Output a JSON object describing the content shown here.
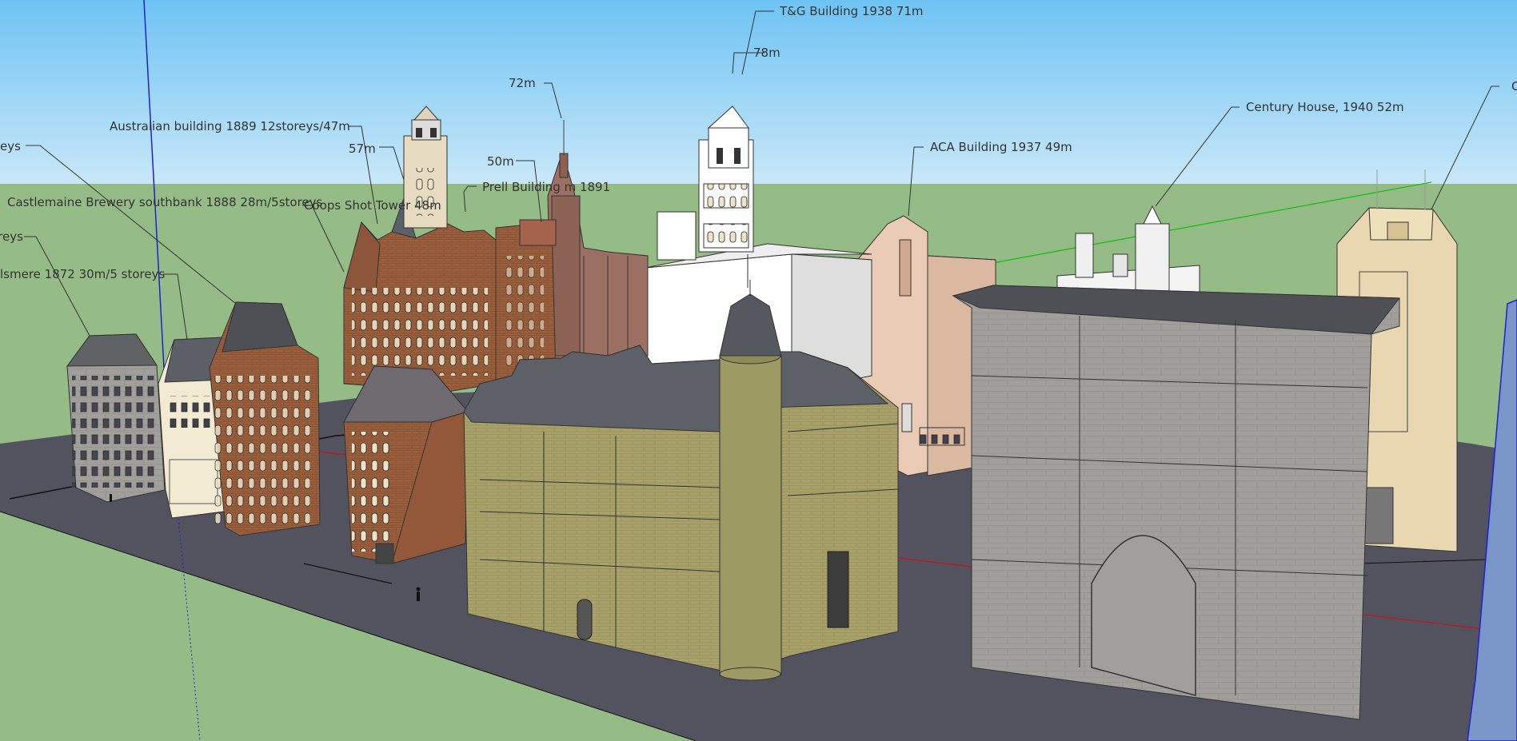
{
  "colors": {
    "sky_top": "#6ec3f4",
    "sky_bottom": "#c6e6f7",
    "ground": "#95bb86",
    "road": "#53535f",
    "brick": "#9a5f3c",
    "sandstone": "#a6a06a",
    "grey_block": "#9c9a96",
    "label_text": "#333333"
  },
  "annotations": [
    {
      "id": "tg-building",
      "text": "T&G Building 1938 71m"
    },
    {
      "id": "tg-height",
      "text": "78m"
    },
    {
      "id": "spire-72",
      "text": "72m"
    },
    {
      "id": "century-house",
      "text": "Century House, 1940 52m"
    },
    {
      "id": "cut-right",
      "text": "C"
    },
    {
      "id": "aca-building",
      "text": "ACA Building 1937 49m"
    },
    {
      "id": "australian-building",
      "text": "Australian building 1889 12storeys/47m"
    },
    {
      "id": "height-57",
      "text": "57m"
    },
    {
      "id": "height-50",
      "text": "50m"
    },
    {
      "id": "prell-building",
      "text": "Prell Building      m 1891"
    },
    {
      "id": "castlemaine-brewery",
      "text": "Castlemaine Brewery southbank 1888 28m/5storeys"
    },
    {
      "id": "coops-shot-tower",
      "text": "Coops Shot Tower      48m"
    },
    {
      "id": "cut-eys",
      "text": "eys"
    },
    {
      "id": "cut-oreys",
      "text": "oreys"
    },
    {
      "id": "ellesmere",
      "text": "lsmere 1872 30m/5 storeys"
    }
  ]
}
